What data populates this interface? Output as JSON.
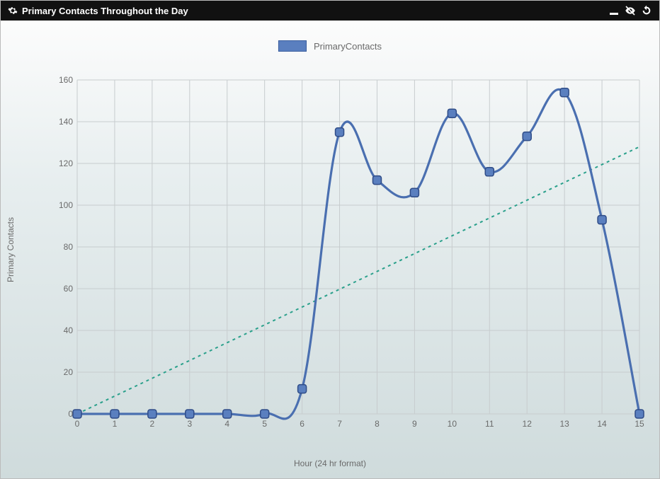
{
  "titlebar": {
    "title": "Primary Contacts Throughout the Day",
    "icons": {
      "gear": "gear-icon",
      "minimize": "minimize-icon",
      "hide": "eye-slash-icon",
      "refresh": "refresh-icon"
    }
  },
  "legend": {
    "series_label": "PrimaryContacts"
  },
  "axes": {
    "ylabel": "Primary Contacts",
    "xlabel": "Hour (24 hr format)"
  },
  "chart_data": {
    "type": "line",
    "title": "Primary Contacts Throughout the Day",
    "xlabel": "Hour (24 hr format)",
    "ylabel": "Primary Contacts",
    "legend": [
      "PrimaryContacts"
    ],
    "x": [
      0,
      1,
      2,
      3,
      4,
      5,
      6,
      7,
      8,
      9,
      10,
      11,
      12,
      13,
      14,
      15
    ],
    "series": [
      {
        "name": "PrimaryContacts",
        "values": [
          0,
          0,
          0,
          0,
          0,
          0,
          12,
          135,
          112,
          106,
          144,
          116,
          133,
          154,
          93,
          0
        ]
      }
    ],
    "trendline": {
      "x": [
        0,
        15
      ],
      "y": [
        0,
        128
      ],
      "style": "dotted",
      "color": "#2aa08b"
    },
    "xlim": [
      0,
      15
    ],
    "ylim": [
      0,
      160
    ],
    "xticks": [
      0,
      1,
      2,
      3,
      4,
      5,
      6,
      7,
      8,
      9,
      10,
      11,
      12,
      13,
      14,
      15
    ],
    "yticks": [
      0,
      20,
      40,
      60,
      80,
      100,
      120,
      140,
      160
    ],
    "grid": true
  },
  "colors": {
    "series": "#4a6fb0",
    "point_fill": "#5a7fbf",
    "point_stroke": "#2f4c87",
    "trend": "#2aa08b",
    "grid": "#c7ccce"
  }
}
